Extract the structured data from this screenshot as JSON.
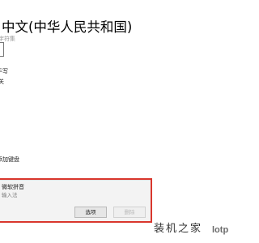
{
  "header": {
    "title": "中文(中华人民共和国)"
  },
  "settings": {
    "row_label_1": "字符集",
    "row_label_2": "手写",
    "row_label_3": "关",
    "add_keyboard": "添加键盘"
  },
  "keyboard": {
    "name": "微软拼音",
    "type": "输入法",
    "options_label": "选项",
    "remove_label": "删除"
  },
  "watermark": {
    "text": "装机之家",
    "url": "lotp"
  },
  "colors": {
    "highlight": "#d9362d",
    "panel_bg": "#f3f3f3"
  }
}
